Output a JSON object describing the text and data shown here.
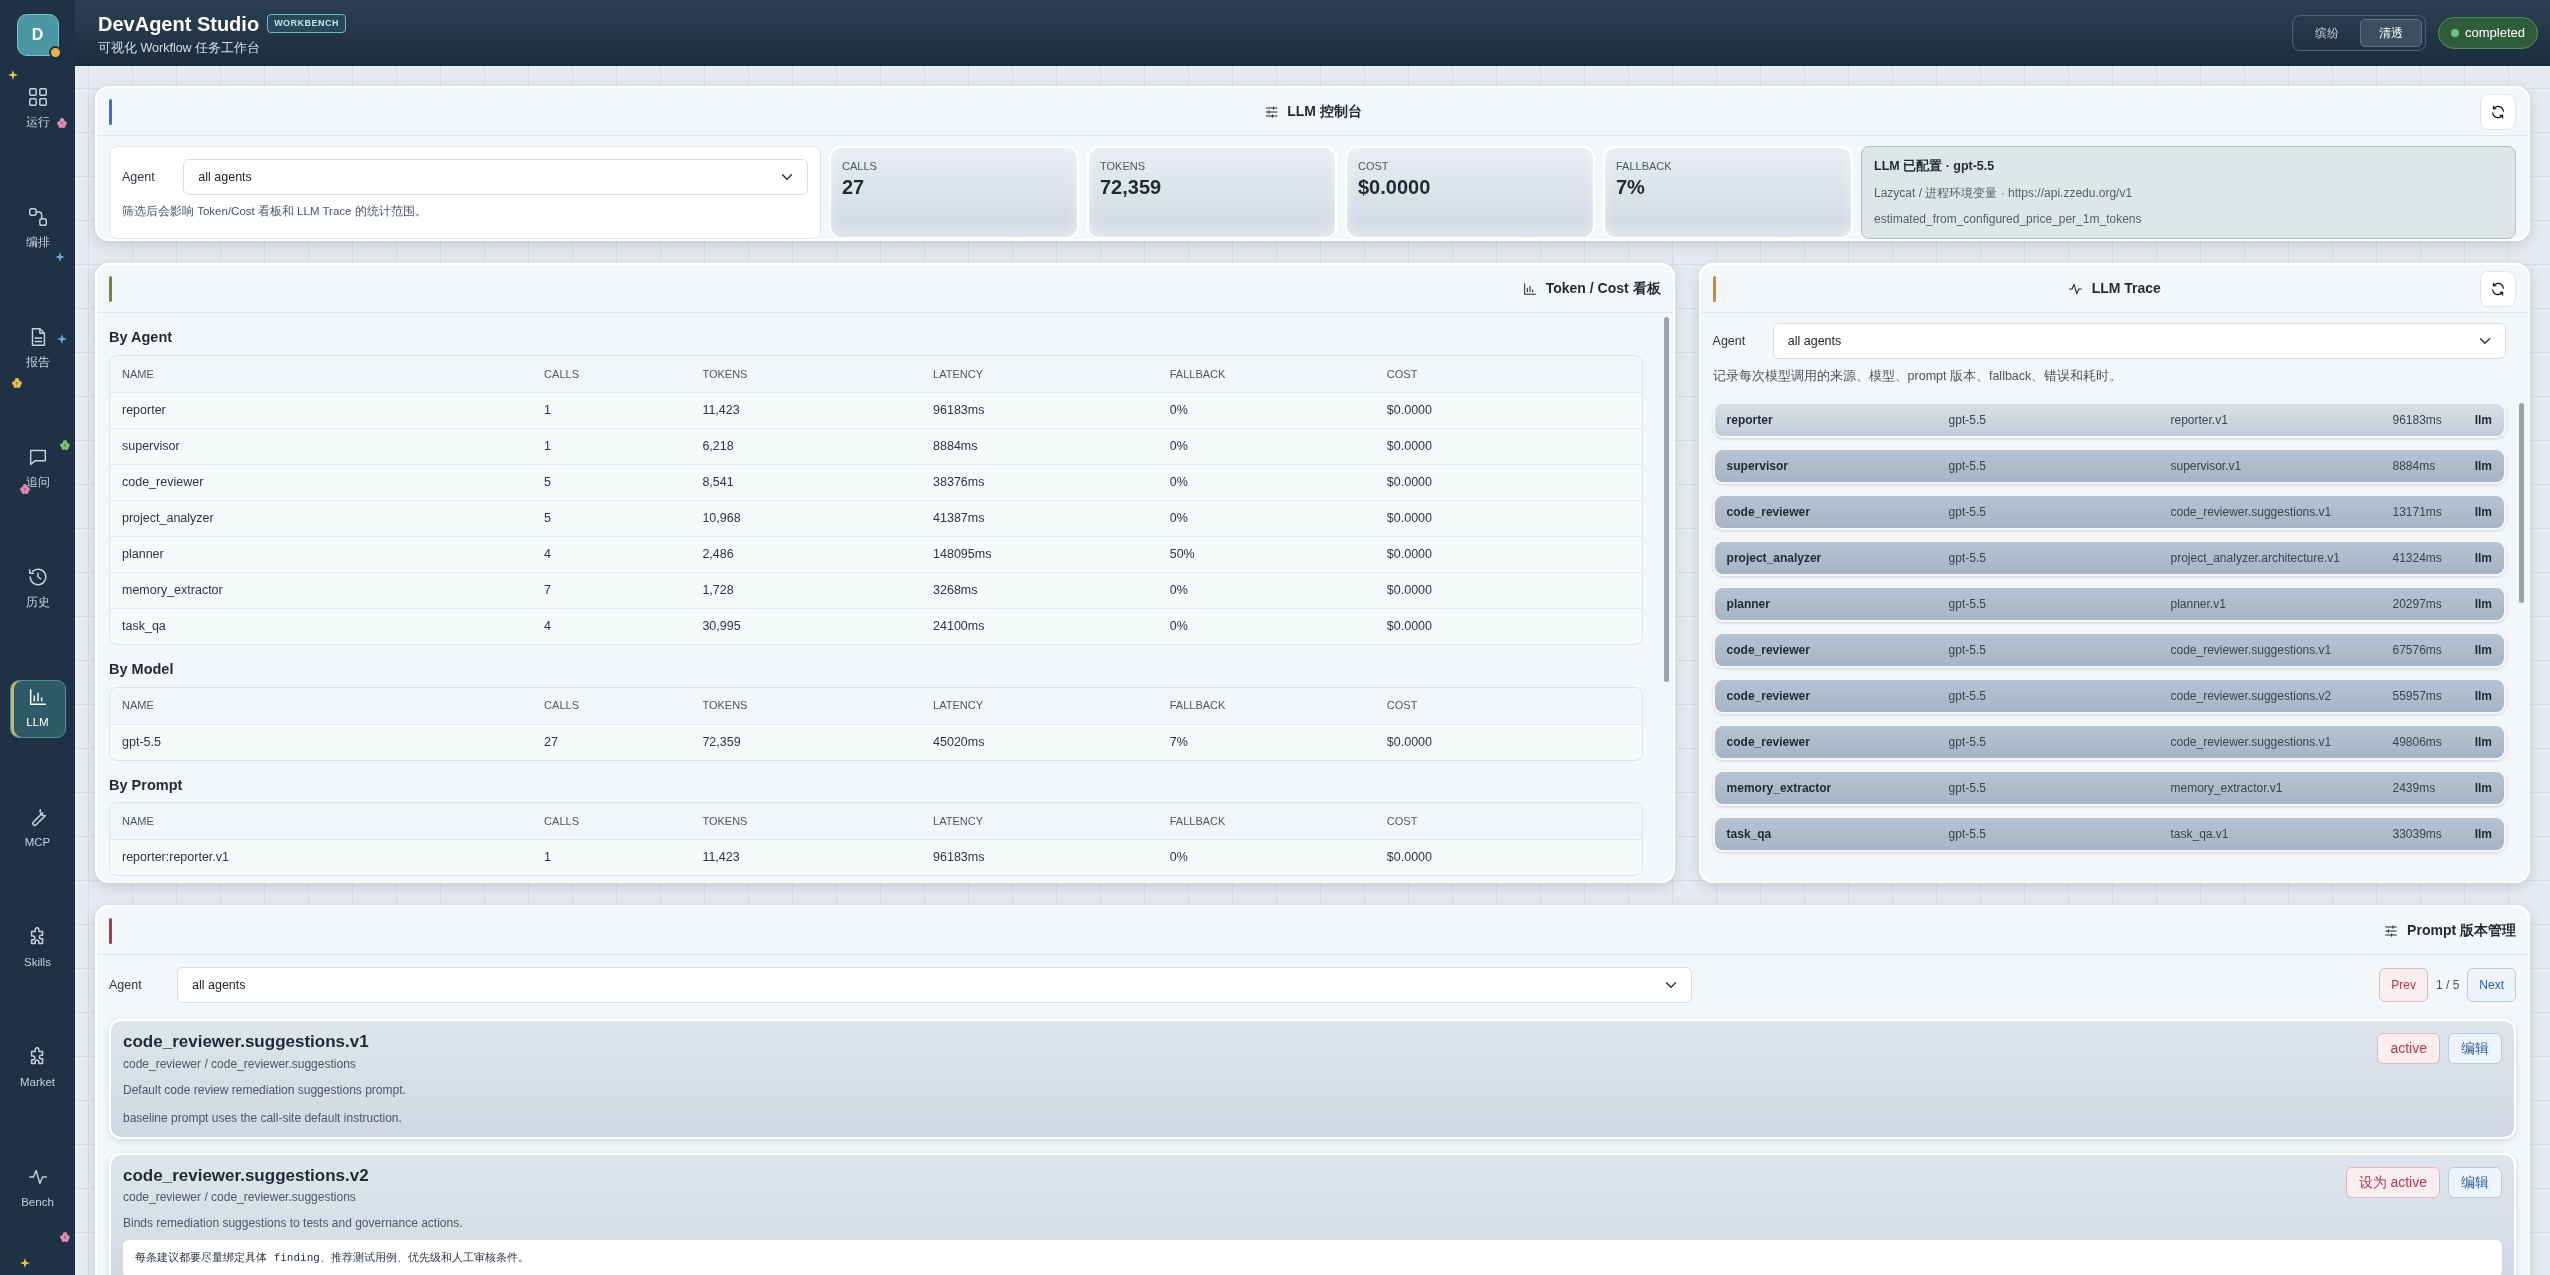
{
  "app": {
    "avatar": "D",
    "title": "DevAgent Studio",
    "badge": "WORKBENCH",
    "subtitle": "可视化 Workflow 任务工作台"
  },
  "sidebar": {
    "items": [
      {
        "label": "运行",
        "selected": false
      },
      {
        "label": "编排",
        "selected": false
      },
      {
        "label": "报告",
        "selected": false
      },
      {
        "label": "追问",
        "selected": false
      },
      {
        "label": "历史",
        "selected": false
      },
      {
        "label": "LLM",
        "selected": true
      },
      {
        "label": "MCP",
        "selected": false
      },
      {
        "label": "Skills",
        "selected": false
      },
      {
        "label": "Market",
        "selected": false
      },
      {
        "label": "Bench",
        "selected": false
      }
    ]
  },
  "theme_toggle": [
    {
      "label": "缤纷",
      "selected": false
    },
    {
      "label": "清透",
      "selected": true
    }
  ],
  "status": {
    "label": "completed"
  },
  "control": {
    "title": "LLM 控制台",
    "filter_label": "Agent",
    "filter_value": "all agents",
    "filter_hint": "筛选后会影响 Token/Cost 看板和 LLM Trace 的统计范围。",
    "stats": [
      {
        "label": "CALLS",
        "value": "27"
      },
      {
        "label": "TOKENS",
        "value": "72,359"
      },
      {
        "label": "COST",
        "value": "$0.0000"
      },
      {
        "label": "FALLBACK",
        "value": "7%"
      }
    ],
    "info": {
      "title": "LLM 已配置 · gpt-5.5",
      "lines": [
        "Lazycat / 进程环境变量 · https://api.zzedu.org/v1",
        "estimated_from_configured_price_per_1m_tokens"
      ]
    }
  },
  "token_cost": {
    "title": "Token / Cost 看板",
    "sections": [
      {
        "heading": "By Agent",
        "columns": [
          "NAME",
          "CALLS",
          "TOKENS",
          "LATENCY",
          "FALLBACK",
          "COST"
        ],
        "rows": [
          [
            "reporter",
            "1",
            "11,423",
            "96183ms",
            "0%",
            "$0.0000"
          ],
          [
            "supervisor",
            "1",
            "6,218",
            "8884ms",
            "0%",
            "$0.0000"
          ],
          [
            "code_reviewer",
            "5",
            "8,541",
            "38376ms",
            "0%",
            "$0.0000"
          ],
          [
            "project_analyzer",
            "5",
            "10,968",
            "41387ms",
            "0%",
            "$0.0000"
          ],
          [
            "planner",
            "4",
            "2,486",
            "148095ms",
            "50%",
            "$0.0000"
          ],
          [
            "memory_extractor",
            "7",
            "1,728",
            "3268ms",
            "0%",
            "$0.0000"
          ],
          [
            "task_qa",
            "4",
            "30,995",
            "24100ms",
            "0%",
            "$0.0000"
          ]
        ]
      },
      {
        "heading": "By Model",
        "columns": [
          "NAME",
          "CALLS",
          "TOKENS",
          "LATENCY",
          "FALLBACK",
          "COST"
        ],
        "rows": [
          [
            "gpt-5.5",
            "27",
            "72,359",
            "45020ms",
            "7%",
            "$0.0000"
          ]
        ]
      },
      {
        "heading": "By Prompt",
        "columns": [
          "NAME",
          "CALLS",
          "TOKENS",
          "LATENCY",
          "FALLBACK",
          "COST"
        ],
        "rows": [
          [
            "reporter:reporter.v1",
            "1",
            "11,423",
            "96183ms",
            "0%",
            "$0.0000"
          ]
        ]
      }
    ]
  },
  "trace": {
    "title": "LLM Trace",
    "filter_label": "Agent",
    "filter_value": "all agents",
    "hint": "记录每次模型调用的来源、模型、prompt 版本、fallback、错误和耗时。",
    "rows": [
      {
        "agent": "reporter",
        "model": "gpt-5.5",
        "prompt": "reporter.v1",
        "latency": "96183ms",
        "type": "llm"
      },
      {
        "agent": "supervisor",
        "model": "gpt-5.5",
        "prompt": "supervisor.v1",
        "latency": "8884ms",
        "type": "llm"
      },
      {
        "agent": "code_reviewer",
        "model": "gpt-5.5",
        "prompt": "code_reviewer.suggestions.v1",
        "latency": "13171ms",
        "type": "llm"
      },
      {
        "agent": "project_analyzer",
        "model": "gpt-5.5",
        "prompt": "project_analyzer.architecture.v1",
        "latency": "41324ms",
        "type": "llm"
      },
      {
        "agent": "planner",
        "model": "gpt-5.5",
        "prompt": "planner.v1",
        "latency": "20297ms",
        "type": "llm"
      },
      {
        "agent": "code_reviewer",
        "model": "gpt-5.5",
        "prompt": "code_reviewer.suggestions.v1",
        "latency": "67576ms",
        "type": "llm"
      },
      {
        "agent": "code_reviewer",
        "model": "gpt-5.5",
        "prompt": "code_reviewer.suggestions.v2",
        "latency": "55957ms",
        "type": "llm"
      },
      {
        "agent": "code_reviewer",
        "model": "gpt-5.5",
        "prompt": "code_reviewer.suggestions.v1",
        "latency": "49806ms",
        "type": "llm"
      },
      {
        "agent": "memory_extractor",
        "model": "gpt-5.5",
        "prompt": "memory_extractor.v1",
        "latency": "2439ms",
        "type": "llm"
      },
      {
        "agent": "task_qa",
        "model": "gpt-5.5",
        "prompt": "task_qa.v1",
        "latency": "33039ms",
        "type": "llm"
      }
    ]
  },
  "prompts": {
    "title": "Prompt 版本管理",
    "filter_label": "Agent",
    "filter_value": "all agents",
    "prev": "Prev",
    "page": "1 / 5",
    "next": "Next",
    "items": [
      {
        "name": "code_reviewer.suggestions.v1",
        "path": "code_reviewer / code_reviewer.suggestions",
        "description": "Default code review remediation suggestions prompt.",
        "note": {
          "kind": "text",
          "text": "baseline prompt uses the call-site default instruction."
        },
        "action": "active",
        "edit": "编辑"
      },
      {
        "name": "code_reviewer.suggestions.v2",
        "path": "code_reviewer / code_reviewer.suggestions",
        "description": "Binds remediation suggestions to tests and governance actions.",
        "note": {
          "kind": "box",
          "text": "每条建议都要尽量绑定具体 finding、推荐测试用例、优先级和人工审核条件。"
        },
        "action": "设为 active",
        "edit": "编辑"
      }
    ]
  }
}
